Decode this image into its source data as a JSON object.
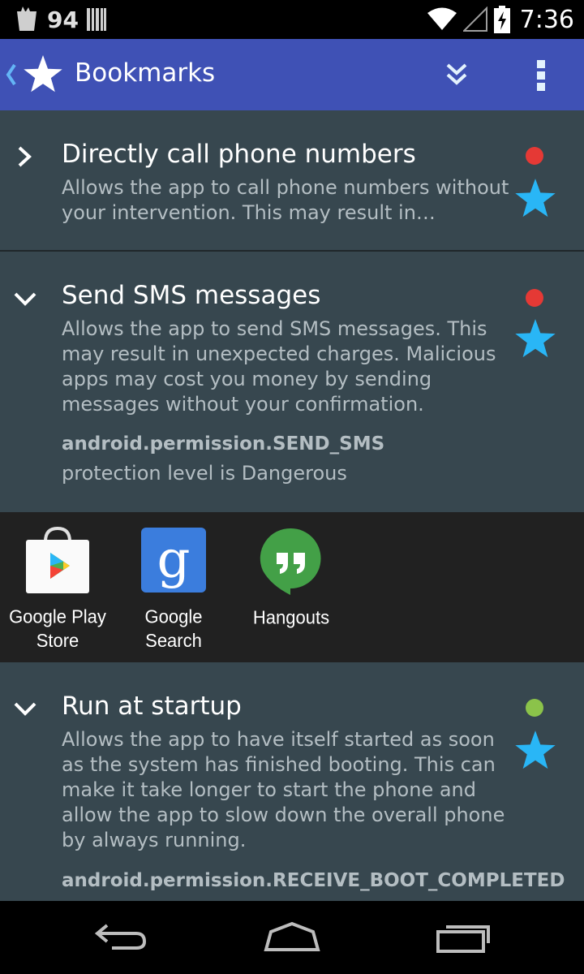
{
  "status_bar": {
    "notification_count": "94",
    "time": "7:36"
  },
  "action_bar": {
    "title": "Bookmarks"
  },
  "permissions": [
    {
      "title": "Directly call phone numbers",
      "description": "Allows the app to call phone numbers without your intervention. This may result in…",
      "expanded": false,
      "danger_color": "#e53935"
    },
    {
      "title": "Send SMS messages",
      "description": "Allows the app to send SMS messages. This may result in unexpected charges. Malicious apps may cost you money by sending messages without your confirmation.",
      "permission_name": "android.permission.SEND_SMS",
      "protection_level": "protection level is Dangerous",
      "expanded": true,
      "danger_color": "#e53935"
    },
    {
      "title": "Run at startup",
      "description": "Allows the app to have itself started as soon as the system has finished booting. This can make it take longer to start the phone and allow the app to slow down the overall phone by always running.",
      "permission_name": "android.permission.RECEIVE_BOOT_COMPLETED",
      "expanded": true,
      "danger_color": "#8bc34a"
    }
  ],
  "apps": [
    {
      "label_line1": "Google Play",
      "label_line2": "Store",
      "icon": "play-store-icon"
    },
    {
      "label_line1": "Google",
      "label_line2": "Search",
      "icon": "google-search-icon"
    },
    {
      "label_line1": "Hangouts",
      "label_line2": "",
      "icon": "hangouts-icon"
    }
  ],
  "colors": {
    "action_bar": "#3f51b5",
    "card_bg": "#37474f",
    "star": "#29b6f6",
    "danger": "#e53935",
    "safe": "#8bc34a"
  }
}
